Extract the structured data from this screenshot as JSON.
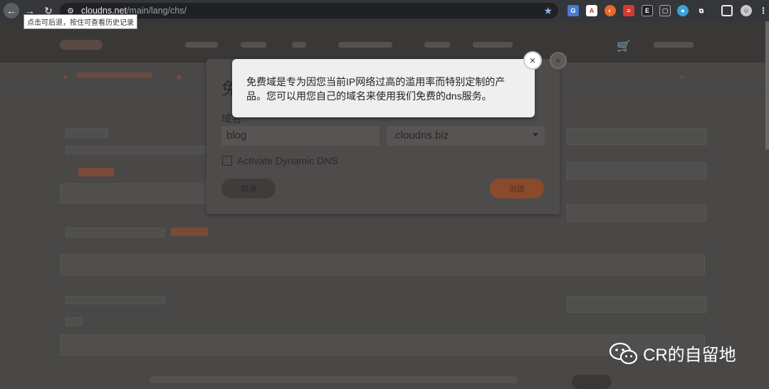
{
  "browser": {
    "url_domain": "cloudns.net",
    "url_path": "/main/lang/chs/",
    "tooltip": "点击可后退，按住可查看历史记录",
    "back_icon": "←",
    "forward_icon": "→",
    "reload_icon": "↻"
  },
  "modal": {
    "title": "免",
    "domain_label": "域名:",
    "domain_value": "blog",
    "zone_select": ".cloudns.biz",
    "dynamic_dns_label": "Activate Dynamic DNS",
    "cancel_label": "取消",
    "create_label": "创建"
  },
  "popup": {
    "text": "免费域是专为因您当前IP网络过高的滥用率而特别定制的产品。您可以用您自己的域名来使用我们免费的dns服务。",
    "close_icon": "×"
  },
  "watermark": {
    "text": "CR的自留地"
  },
  "colors": {
    "accent": "#e8592a",
    "overlay": "#4a4847",
    "popup_bg": "#efefef"
  }
}
